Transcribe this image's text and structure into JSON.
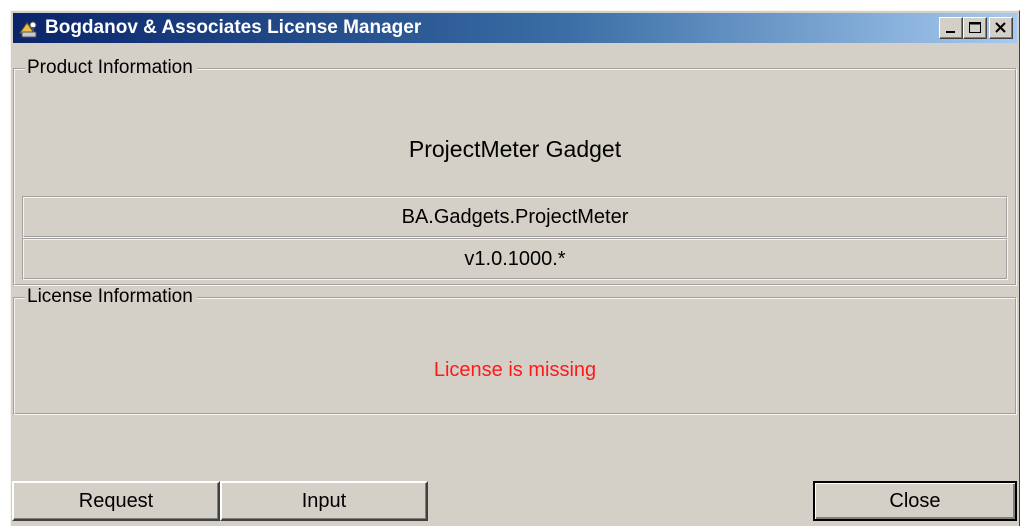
{
  "window": {
    "title": "Bogdanov & Associates License Manager",
    "icon": "license-app-icon"
  },
  "product_group": {
    "legend": "Product Information",
    "product_name": "ProjectMeter Gadget",
    "product_id": "BA.Gadgets.ProjectMeter",
    "version": "v1.0.1000.*"
  },
  "license_group": {
    "legend": "License Information",
    "status": "License is missing",
    "status_color": "#ff1a1a"
  },
  "buttons": {
    "request": "Request",
    "input": "Input",
    "close": "Close"
  },
  "colors": {
    "titlebar_start": "#0a246a",
    "titlebar_end": "#a6caf0",
    "window_face": "#d4d0c8"
  }
}
